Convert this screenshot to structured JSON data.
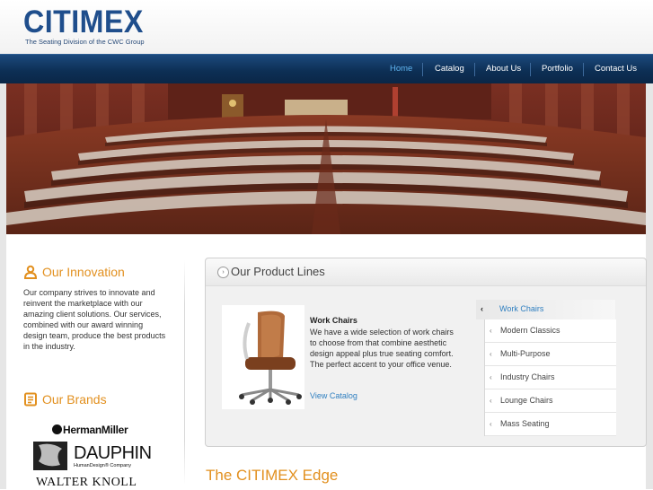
{
  "brand": {
    "name": "CITIMEX",
    "tagline": "The Seating Division of the CWC Group"
  },
  "nav": {
    "items": [
      {
        "label": "Home",
        "active": true
      },
      {
        "label": "Catalog",
        "active": false
      },
      {
        "label": "About Us",
        "active": false
      },
      {
        "label": "Portfolio",
        "active": false
      },
      {
        "label": "Contact Us",
        "active": false
      }
    ]
  },
  "innovation": {
    "title": "Our Innovation",
    "icon": "person-icon",
    "text": "Our company strives to innovate and reinvent the marketplace with our amazing client solutions. Our services, combined with our award winning design team, produce the best products in the industry."
  },
  "brands": {
    "title": "Our Brands",
    "icon": "document-icon",
    "logos": [
      "HermanMiller",
      "DAUPHIN",
      "HumanDesign® Company",
      "WALTER KNOLL"
    ]
  },
  "products": {
    "title": "Our Product Lines",
    "featured": {
      "name": "Work Chairs",
      "description": "We have a wide selection of work chairs to choose from that combine aesthetic design appeal plus true seating comfort. The perfect accent to your office venue.",
      "link": "View Catalog"
    },
    "tabs": [
      "Work Chairs",
      "Modern Classics",
      "Multi-Purpose",
      "Industry Chairs",
      "Lounge Chairs",
      "Mass Seating"
    ]
  },
  "edge": {
    "title": "The CITIMEX Edge"
  },
  "colors": {
    "navy": "#1f4e8c",
    "orange": "#e2901f",
    "link": "#2f7fc0",
    "nav_active": "#5fb4f0"
  }
}
